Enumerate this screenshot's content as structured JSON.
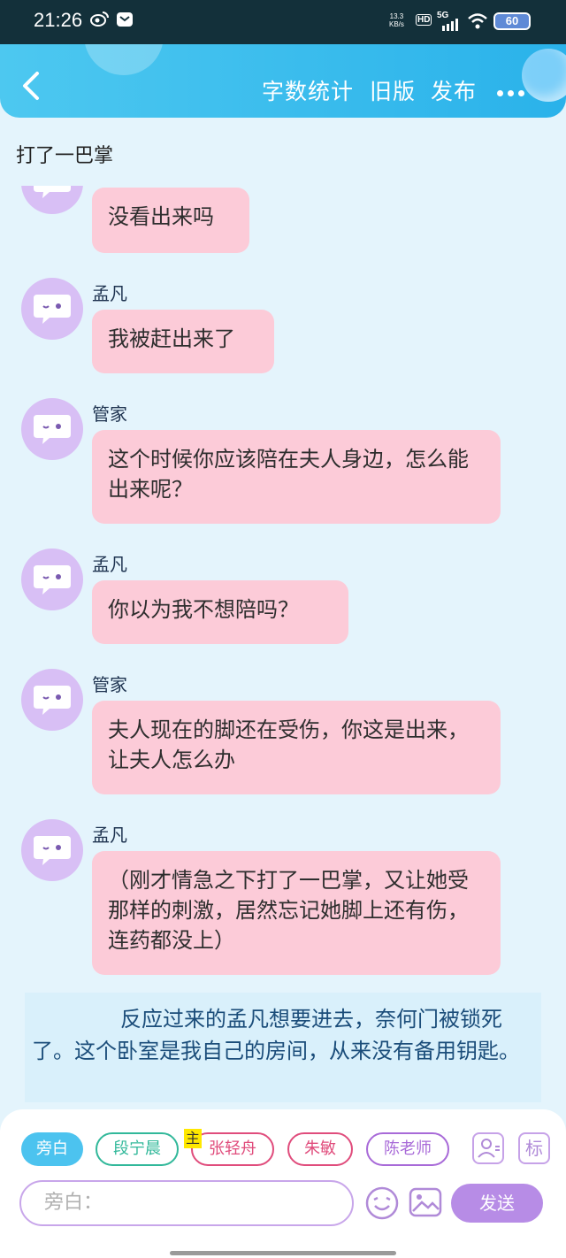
{
  "status_bar": {
    "time": "21:26",
    "net_speed_value": "13.3",
    "net_speed_unit": "KB/s",
    "hd": "HD",
    "network": "5G",
    "battery": "60"
  },
  "header": {
    "word_count_label": "字数统计",
    "old_version_label": "旧版",
    "publish_label": "发布"
  },
  "chapter_title": "打了一巴掌",
  "messages": [
    {
      "speaker": "",
      "text": "没看出来吗"
    },
    {
      "speaker": "孟凡",
      "text": "我被赶出来了"
    },
    {
      "speaker": "管家",
      "text": "这个时候你应该陪在夫人身边，怎么能出来呢？"
    },
    {
      "speaker": "孟凡",
      "text": "你以为我不想陪吗？"
    },
    {
      "speaker": "管家",
      "text": "夫人现在的脚还在受伤，你这是出来，让夫人怎么办"
    },
    {
      "speaker": "孟凡",
      "text": "（刚才情急之下打了一巴掌，又让她受那样的刺激，居然忘记她脚上还有伤，连药都没上）"
    }
  ],
  "narration": "反应过来的孟凡想要进去，奈何门被锁死了。这个卧室是我自己的房间，从来没有备用钥匙。",
  "composer": {
    "narration_chip": "旁白",
    "characters": [
      "段宁晨",
      "张轻舟",
      "朱敏",
      "陈老师"
    ],
    "main_tag": "主",
    "mark_label": "标",
    "input_placeholder": "旁白：",
    "send_label": "发送"
  },
  "colors": {
    "header": "#2ab2ea",
    "bubble": "#fccbd8",
    "avatar": "#d8bff5",
    "send": "#b78ce6"
  }
}
